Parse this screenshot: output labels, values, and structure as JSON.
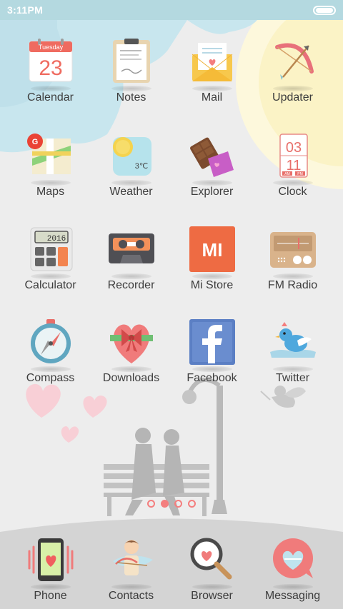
{
  "status_bar": {
    "time": "3:11PM",
    "battery_level": 1.0
  },
  "home_rows": [
    [
      {
        "label": "Calendar",
        "icon": "calendar-icon",
        "sub": "Tuesday",
        "day": "23"
      },
      {
        "label": "Notes",
        "icon": "notes-icon"
      },
      {
        "label": "Mail",
        "icon": "mail-icon"
      },
      {
        "label": "Updater",
        "icon": "bow-arrow-icon"
      }
    ],
    [
      {
        "label": "Maps",
        "icon": "maps-icon"
      },
      {
        "label": "Weather",
        "icon": "weather-icon",
        "temp": "3℃"
      },
      {
        "label": "Explorer",
        "icon": "explorer-icon"
      },
      {
        "label": "Clock",
        "icon": "clock-icon",
        "hour": "03",
        "minute": "11",
        "am": "AM",
        "pm": "PM"
      }
    ],
    [
      {
        "label": "Calculator",
        "icon": "calculator-icon",
        "display": "2016"
      },
      {
        "label": "Recorder",
        "icon": "cassette-icon"
      },
      {
        "label": "Mi Store",
        "icon": "mi-store-icon",
        "logo": "MI"
      },
      {
        "label": "FM Radio",
        "icon": "radio-icon"
      }
    ],
    [
      {
        "label": "Compass",
        "icon": "compass-icon"
      },
      {
        "label": "Downloads",
        "icon": "heart-gift-icon"
      },
      {
        "label": "Facebook",
        "icon": "facebook-icon"
      },
      {
        "label": "Twitter",
        "icon": "bird-icon"
      }
    ]
  ],
  "page_indicator": {
    "count": 4,
    "active": 1
  },
  "dock": [
    {
      "label": "Phone",
      "icon": "phone-icon"
    },
    {
      "label": "Contacts",
      "icon": "cupid-icon"
    },
    {
      "label": "Browser",
      "icon": "magnifier-icon"
    },
    {
      "label": "Messaging",
      "icon": "message-bubble-icon"
    }
  ],
  "colors": {
    "status_bar": "#b4d9e0",
    "cloud": "#c8e6ee",
    "accent": "#f47e7e"
  }
}
